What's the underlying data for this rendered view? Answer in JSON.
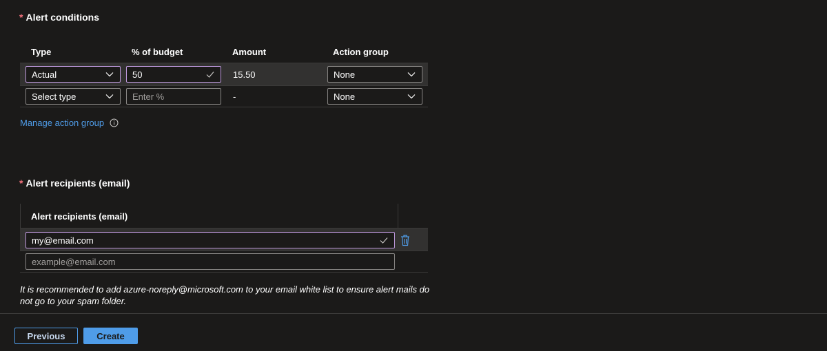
{
  "alert_conditions": {
    "title": "Alert conditions",
    "required_marker": "*",
    "columns": [
      "Type",
      "% of budget",
      "Amount",
      "Action group"
    ],
    "rows": [
      {
        "type": "Actual",
        "percent": "50",
        "amount": "15.50",
        "action_group": "None"
      },
      {
        "type_placeholder": "Select type",
        "percent_placeholder": "Enter %",
        "amount": "-",
        "action_group": "None"
      }
    ],
    "manage_link": "Manage action group"
  },
  "alert_recipients": {
    "title": "Alert recipients (email)",
    "required_marker": "*",
    "column": "Alert recipients (email)",
    "emails": [
      "my@email.com"
    ],
    "email_placeholder": "example@email.com"
  },
  "note": "It is recommended to add azure-noreply@microsoft.com to your email white list to ensure alert mails do not go to your spam folder.",
  "footer": {
    "previous_label": "Previous",
    "create_label": "Create"
  },
  "colors": {
    "background": "#1b1a19",
    "accent": "#4f9ce8",
    "active_border": "#c19be0",
    "required": "#f1707b"
  },
  "icons": [
    "chevron-down-icon",
    "checkmark-icon",
    "info-icon",
    "trash-icon"
  ]
}
